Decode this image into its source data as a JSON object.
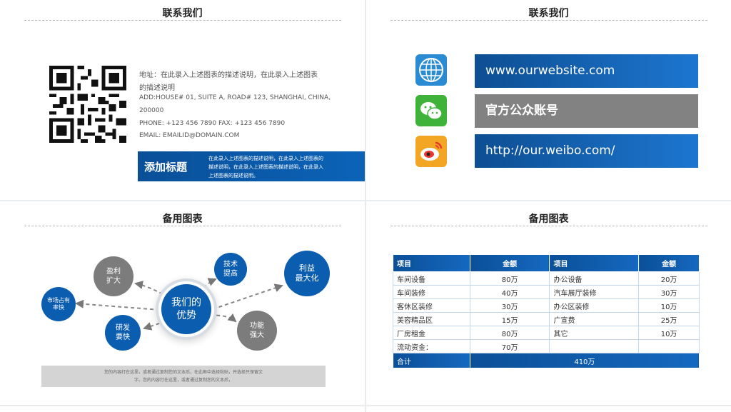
{
  "slide1": {
    "title": "联系我们",
    "address_line1": "地址：在此录入上述图表的描述说明，在此录入上述图表",
    "address_line2": "的描述说明",
    "address_en1": "ADD:HOUSE# 01, SUITE A, ROAD# 123, SHANGHAI, CHINA,",
    "address_en2": "200000",
    "phone": "PHONE: +123 456 7890 FAX: +123 456 7890",
    "email": "EMAIL: EMAILID@DOMAIN.COM",
    "bar_title": "添加标题",
    "bar_text": "在此录入上述图表的描述说明，在此录入上述图表的描述说明，在此录入上述图表的描述说明，在此录入上述图表的描述说明。"
  },
  "slide2": {
    "title": "联系我们",
    "website": "www.ourwebsite.com",
    "wechat": "官方公众账号",
    "weibo": "http://our.weibo.com/",
    "icons": [
      "globe-icon",
      "wechat-icon",
      "weibo-icon"
    ]
  },
  "slide3": {
    "title": "备用图表",
    "center": "我们的\n优势",
    "c_profit": "盈利\n扩大",
    "c_tech": "技术\n提高",
    "c_maxprofit": "利益\n最大化",
    "c_market": "市场占有\n率快",
    "c_rnd": "研发\n要快",
    "c_func": "功能\n强大",
    "note_line1": "您的内容打在这里，或者通过复制您的文本后，在此框中选择粘贴，并选择只保留文",
    "note_line2": "字。您的内容打在这里，或者通过复制您的文本后，"
  },
  "slide4": {
    "title": "备用图表",
    "headers": [
      "项目",
      "金额",
      "项目",
      "金额"
    ],
    "rows": [
      [
        "车间设备",
        "80万",
        "办公设备",
        "20万"
      ],
      [
        "车间装修",
        "40万",
        "汽车展厅装修",
        "30万"
      ],
      [
        "客休区装修",
        "30万",
        "办公区装修",
        "10万"
      ],
      [
        "美容精品区",
        "15万",
        "广宣费",
        "25万"
      ],
      [
        "厂房租金",
        "80万",
        "其它",
        "10万"
      ],
      [
        "流动资金：",
        "70万",
        "",
        ""
      ]
    ],
    "total_label": "合计",
    "total_value": "410万"
  }
}
